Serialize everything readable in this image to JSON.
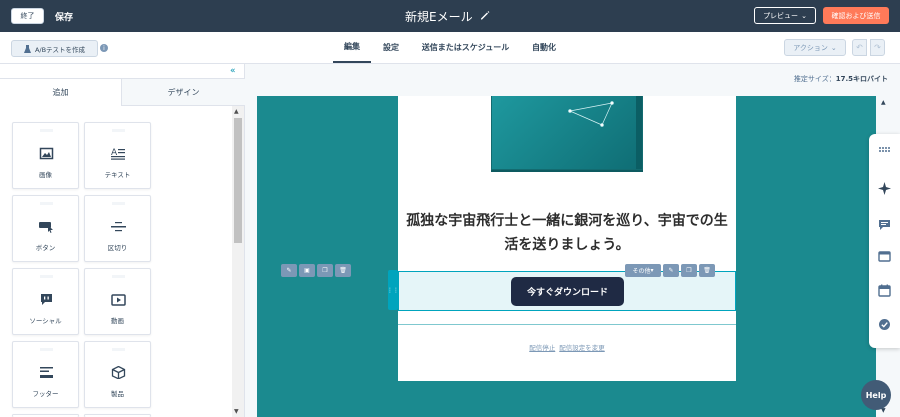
{
  "topbar": {
    "exit_label": "終了",
    "save_label": "保存",
    "title": "新規Eメール",
    "preview_label": "プレビュー",
    "review_label": "確認および送信"
  },
  "subbar": {
    "ab_test_label": "A/Bテストを作成",
    "tabs": [
      {
        "label": "編集",
        "active": true
      },
      {
        "label": "設定",
        "active": false
      },
      {
        "label": "送信またはスケジュール",
        "active": false
      },
      {
        "label": "自動化",
        "active": false
      }
    ],
    "action_label": "アクション"
  },
  "left_panel": {
    "tab_add": "追加",
    "tab_design": "デザイン",
    "modules": [
      {
        "label": "画像",
        "icon": "image-icon"
      },
      {
        "label": "テキスト",
        "icon": "text-icon"
      },
      {
        "label": "ボタン",
        "icon": "button-icon"
      },
      {
        "label": "区切り",
        "icon": "divider-icon"
      },
      {
        "label": "ソーシャル",
        "icon": "social-icon"
      },
      {
        "label": "動画",
        "icon": "video-icon"
      },
      {
        "label": "フッター",
        "icon": "footer-icon"
      },
      {
        "label": "製品",
        "icon": "product-icon"
      }
    ]
  },
  "canvas": {
    "size_label": "推定サイズ：",
    "size_value": "17.5キロバイト",
    "headline": "孤独な宇宙飛行士と一緒に銀河を巡り、宇宙での生活を送りましょう。",
    "cta_label": "今すぐダウンロード",
    "toolbar_more_label": "その他",
    "footer_unsubscribe": "配信停止",
    "footer_preferences": "配信設定を変更",
    "background_color": "#1b8a8f"
  },
  "help_label": "Help"
}
